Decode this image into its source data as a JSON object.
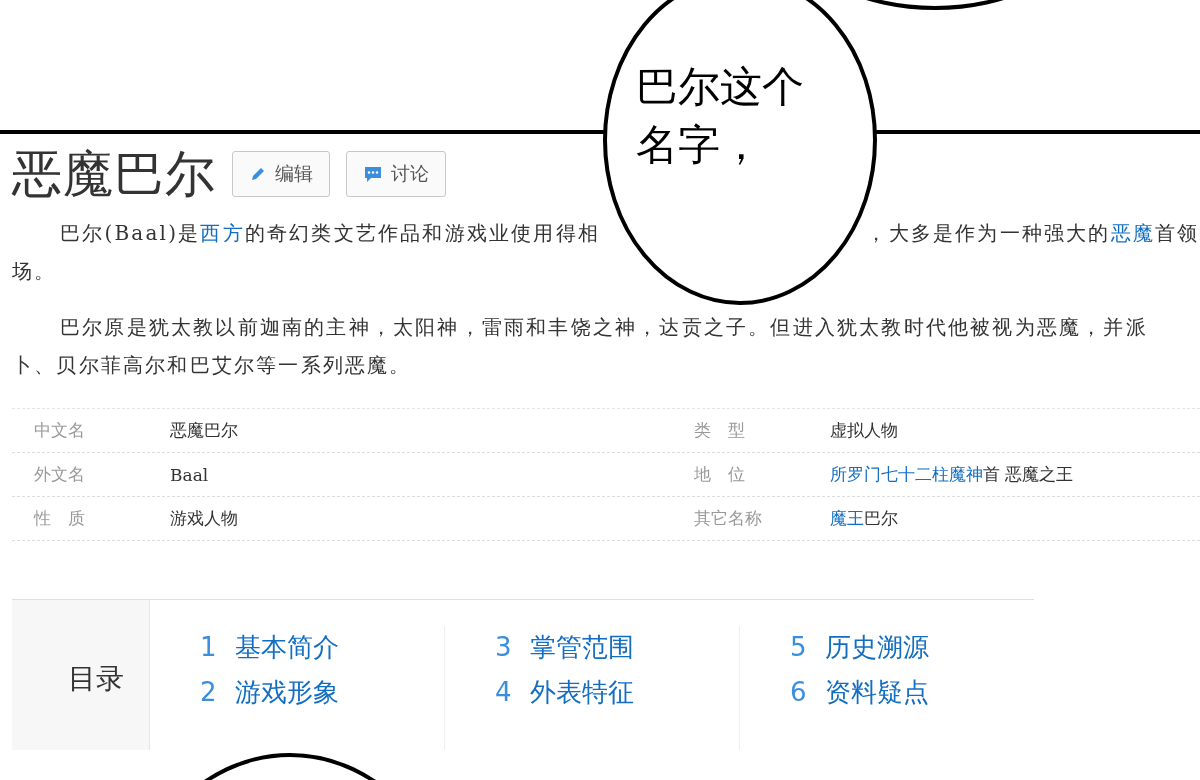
{
  "speech_bubbles": [
    {
      "kind": "oval",
      "lines": [
        "巴尔这个",
        "名字，"
      ]
    },
    {
      "kind": "oval"
    }
  ],
  "article": {
    "title": "恶魔巴尔",
    "buttons": [
      {
        "label": "编辑",
        "kind": "edit"
      },
      {
        "label": "讨论",
        "kind": "discuss"
      }
    ]
  },
  "paragraphs": [
    {
      "lines": [
        [
          {
            "text": "巴尔(Baal)是",
            "link": false
          },
          {
            "text": "西方",
            "link": true
          },
          {
            "text": "的奇幻类文艺作品和游戏业使用得相",
            "link": false
          },
          {
            "kind": "covered"
          },
          {
            "text": "，大多是作为一种强大的",
            "link": false
          },
          {
            "text": "恶魔",
            "link": true
          },
          {
            "text": "首领",
            "link": false
          }
        ],
        [
          {
            "text": "场。",
            "link": false
          }
        ]
      ]
    },
    {
      "lines": [
        [
          {
            "text": "巴尔原是犹太教以前迦南的主神，太阳神，雷雨和丰饶之神，达贡之子。但进入犹太教时代他被视为恶魔，并派",
            "link": false
          }
        ],
        [
          {
            "text": "卜、贝尔菲高尔和巴艾尔等一系列恶魔。",
            "link": false
          }
        ]
      ]
    }
  ],
  "basic_info": [
    [
      {
        "name": "中文名",
        "value": [
          {
            "text": "恶魔巴尔",
            "link": false
          }
        ]
      },
      {
        "name": "类　型",
        "value": [
          {
            "text": "虚拟人物",
            "link": false
          }
        ]
      }
    ],
    [
      {
        "name": "外文名",
        "value": [
          {
            "text": "Baal",
            "link": false
          }
        ]
      },
      {
        "name": "地　位",
        "value": [
          {
            "text": "所罗门七十二柱魔神",
            "link": true
          },
          {
            "text": "首 恶魔之王",
            "link": false
          }
        ]
      }
    ],
    [
      {
        "name": "性　质",
        "value": [
          {
            "text": "游戏人物",
            "link": false
          }
        ]
      },
      {
        "name": "其它名称",
        "value": [
          {
            "text": "魔王",
            "link": true
          },
          {
            "text": "巴尔",
            "link": false
          }
        ]
      }
    ]
  ],
  "contents": {
    "title": "目录",
    "columns": [
      [
        {
          "number": "1",
          "label": "基本简介"
        },
        {
          "number": "2",
          "label": "游戏形象"
        }
      ],
      [
        {
          "number": "3",
          "label": "掌管范围"
        },
        {
          "number": "4",
          "label": "外表特征"
        }
      ],
      [
        {
          "number": "5",
          "label": "历史溯源"
        },
        {
          "number": "6",
          "label": "资料疑点"
        }
      ]
    ]
  }
}
